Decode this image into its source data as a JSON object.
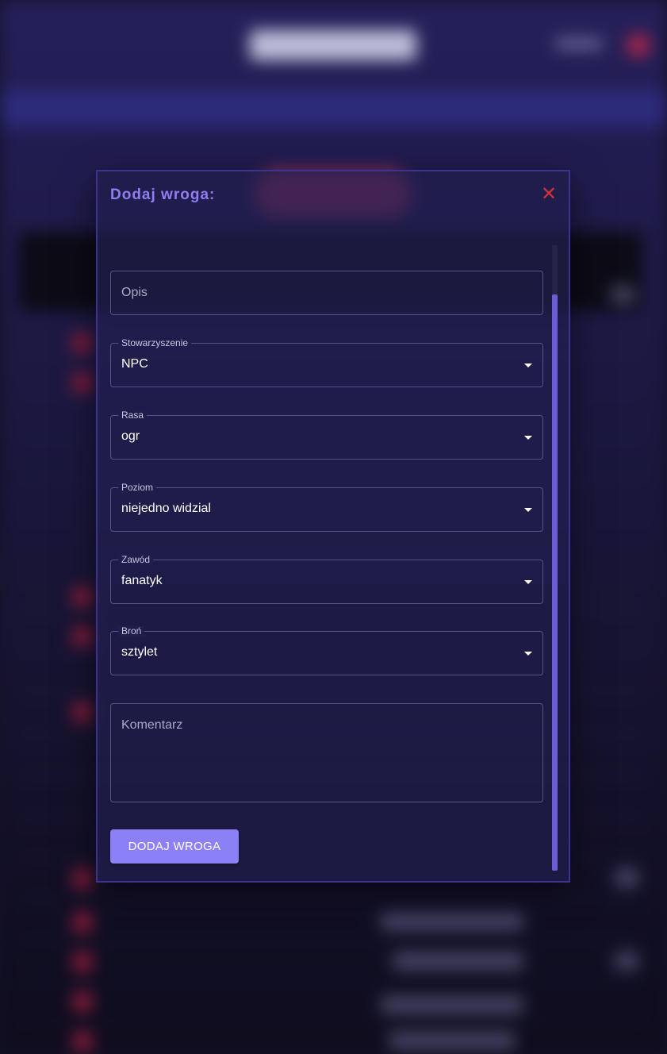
{
  "modal": {
    "title": "Dodaj wroga:",
    "close_icon": "✕",
    "fields": {
      "opis": {
        "placeholder": "Opis"
      },
      "stowarzyszenie": {
        "label": "Stowarzyszenie",
        "value": "NPC"
      },
      "rasa": {
        "label": "Rasa",
        "value": "ogr"
      },
      "poziom": {
        "label": "Poziom",
        "value": "niejedno widzial"
      },
      "zawod": {
        "label": "Zawód",
        "value": "fanatyk"
      },
      "bron": {
        "label": "Broń",
        "value": "sztylet"
      },
      "komentarz": {
        "placeholder": "Komentarz"
      }
    },
    "submit_label": "DODAJ WROGA"
  },
  "colors": {
    "accent": "#8b80f5",
    "title": "#8f7ef2",
    "close": "#d0323c",
    "scrollbar": "#6c5dd6"
  }
}
